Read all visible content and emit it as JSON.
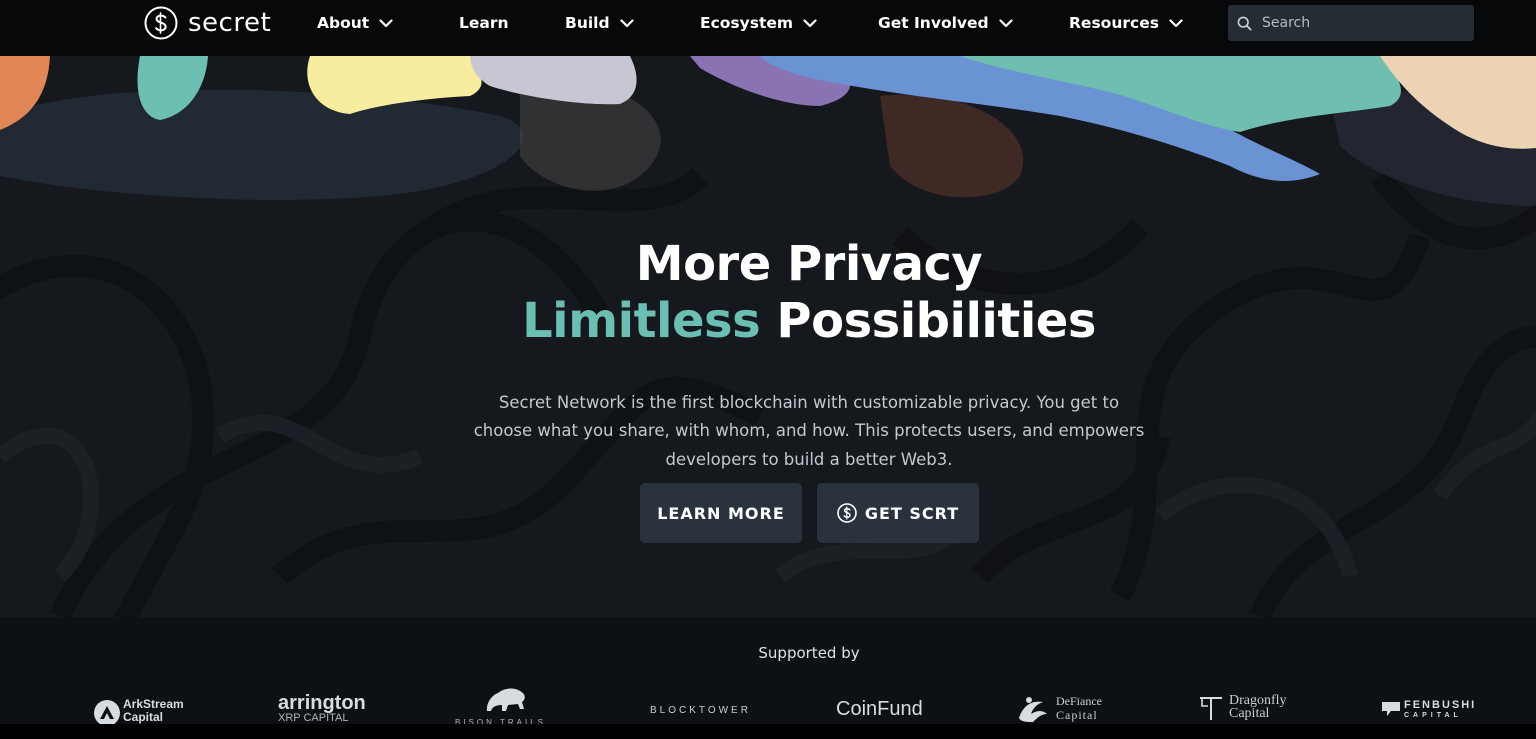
{
  "brand": {
    "name": "secret"
  },
  "nav": {
    "items": [
      {
        "label": "About",
        "dropdown": true
      },
      {
        "label": "Learn",
        "dropdown": false
      },
      {
        "label": "Build",
        "dropdown": true
      },
      {
        "label": "Ecosystem",
        "dropdown": true
      },
      {
        "label": "Get Involved",
        "dropdown": true
      },
      {
        "label": "Resources",
        "dropdown": true
      }
    ],
    "search_placeholder": "Search"
  },
  "hero": {
    "title_line1": "More Privacy",
    "title_accent": "Limitless",
    "title_line2_rest": "Possibilities",
    "description": "Secret Network is the first blockchain with customizable privacy. You get to choose what you share, with whom, and how. This protects users, and empowers developers to build a better Web3.",
    "btn_learn": "LEARN MORE",
    "btn_get": "GET SCRT"
  },
  "supported": {
    "title": "Supported by",
    "partners": [
      {
        "line1": "ArkStream",
        "line2": "Capital"
      },
      {
        "line1": "arrington",
        "line2": "XRP CAPITAL"
      },
      {
        "line1": "BISON TRAILS"
      },
      {
        "line1": "BLOCKTOWER"
      },
      {
        "line1": "CoinFund"
      },
      {
        "line1": "DeFiance",
        "line2": "Capital"
      },
      {
        "line1": "Dragonfly",
        "line2": "Capital"
      },
      {
        "line1": "FENBUSHI",
        "line2": "CAPITAL"
      }
    ]
  },
  "colors": {
    "nav_bg": "#070809",
    "hero_bg": "#15181c",
    "accent_teal": "#6bbfb2",
    "button_bg": "#2a333d",
    "search_bg": "#262c33"
  }
}
